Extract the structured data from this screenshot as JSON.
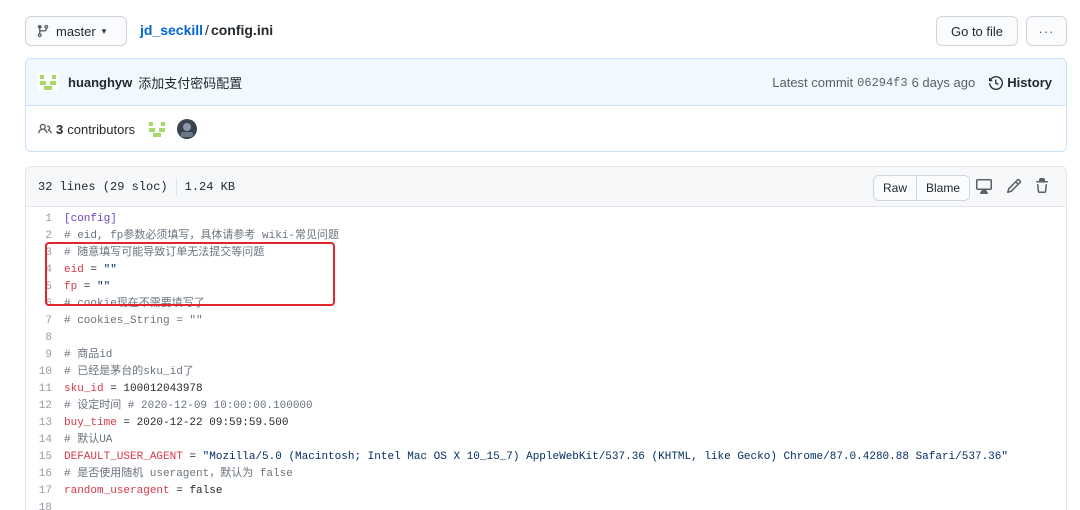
{
  "topbar": {
    "branch": "master",
    "repo": "jd_seckill",
    "separator": "/",
    "file": "config.ini",
    "goto_file": "Go to file",
    "more": "···"
  },
  "commit": {
    "author": "huanghyw",
    "message": "添加支付密码配置",
    "latest_label": "Latest commit",
    "sha": "06294f3",
    "age": "6 days ago",
    "history": "History"
  },
  "contributors": {
    "count": "3",
    "label": "contributors"
  },
  "file": {
    "lines_info": "32 lines (29 sloc)",
    "size": "1.24 KB",
    "raw": "Raw",
    "blame": "Blame"
  },
  "code_lines": [
    {
      "n": "1",
      "parts": [
        {
          "t": "[config]",
          "c": "sec"
        }
      ]
    },
    {
      "n": "2",
      "parts": [
        {
          "t": "# eid, fp参数必须填写，具体请参考 wiki-常见问题",
          "c": "com"
        }
      ]
    },
    {
      "n": "3",
      "parts": [
        {
          "t": "# 随意填写可能导致订单无法提交等问题",
          "c": "com"
        }
      ]
    },
    {
      "n": "4",
      "parts": [
        {
          "t": "eid",
          "c": "key"
        },
        {
          "t": " = ",
          "c": ""
        },
        {
          "t": "\"\"",
          "c": "str"
        }
      ]
    },
    {
      "n": "5",
      "parts": [
        {
          "t": "fp",
          "c": "key"
        },
        {
          "t": " = ",
          "c": ""
        },
        {
          "t": "\"\"",
          "c": "str"
        }
      ]
    },
    {
      "n": "6",
      "parts": [
        {
          "t": "# cookie现在不需要填写了",
          "c": "com"
        }
      ]
    },
    {
      "n": "7",
      "parts": [
        {
          "t": "# cookies_String = \"\"",
          "c": "com"
        }
      ]
    },
    {
      "n": "8",
      "parts": []
    },
    {
      "n": "9",
      "parts": [
        {
          "t": "# 商品id",
          "c": "com"
        }
      ]
    },
    {
      "n": "10",
      "parts": [
        {
          "t": "# 已经是茅台的sku_id了",
          "c": "com"
        }
      ]
    },
    {
      "n": "11",
      "parts": [
        {
          "t": "sku_id",
          "c": "key"
        },
        {
          "t": " = ",
          "c": ""
        },
        {
          "t": "100012043978",
          "c": "num"
        }
      ]
    },
    {
      "n": "12",
      "parts": [
        {
          "t": "# 设定时间 # 2020-12-09 10:00:00.100000",
          "c": "com"
        }
      ]
    },
    {
      "n": "13",
      "parts": [
        {
          "t": "buy_time",
          "c": "key"
        },
        {
          "t": " = ",
          "c": ""
        },
        {
          "t": "2020-12-22 09:59:59.500",
          "c": "num"
        }
      ]
    },
    {
      "n": "14",
      "parts": [
        {
          "t": "# 默认UA",
          "c": "com"
        }
      ]
    },
    {
      "n": "15",
      "parts": [
        {
          "t": "DEFAULT_USER_AGENT",
          "c": "key"
        },
        {
          "t": " = ",
          "c": ""
        },
        {
          "t": "\"Mozilla/5.0 (Macintosh; Intel Mac OS X 10_15_7) AppleWebKit/537.36 (KHTML, like Gecko) Chrome/87.0.4280.88 Safari/537.36\"",
          "c": "str"
        }
      ]
    },
    {
      "n": "16",
      "parts": [
        {
          "t": "# 是否使用随机 useragent，默认为 false",
          "c": "com"
        }
      ]
    },
    {
      "n": "17",
      "parts": [
        {
          "t": "random_useragent",
          "c": "key"
        },
        {
          "t": " = ",
          "c": ""
        },
        {
          "t": "false",
          "c": "num"
        }
      ]
    },
    {
      "n": "18",
      "parts": []
    }
  ],
  "colors": {
    "link": "#0366d6",
    "highlight_border": "#e0262b",
    "key": "#d73a49",
    "string": "#032f62",
    "comment": "#6a737d",
    "section": "#6f42c1"
  }
}
